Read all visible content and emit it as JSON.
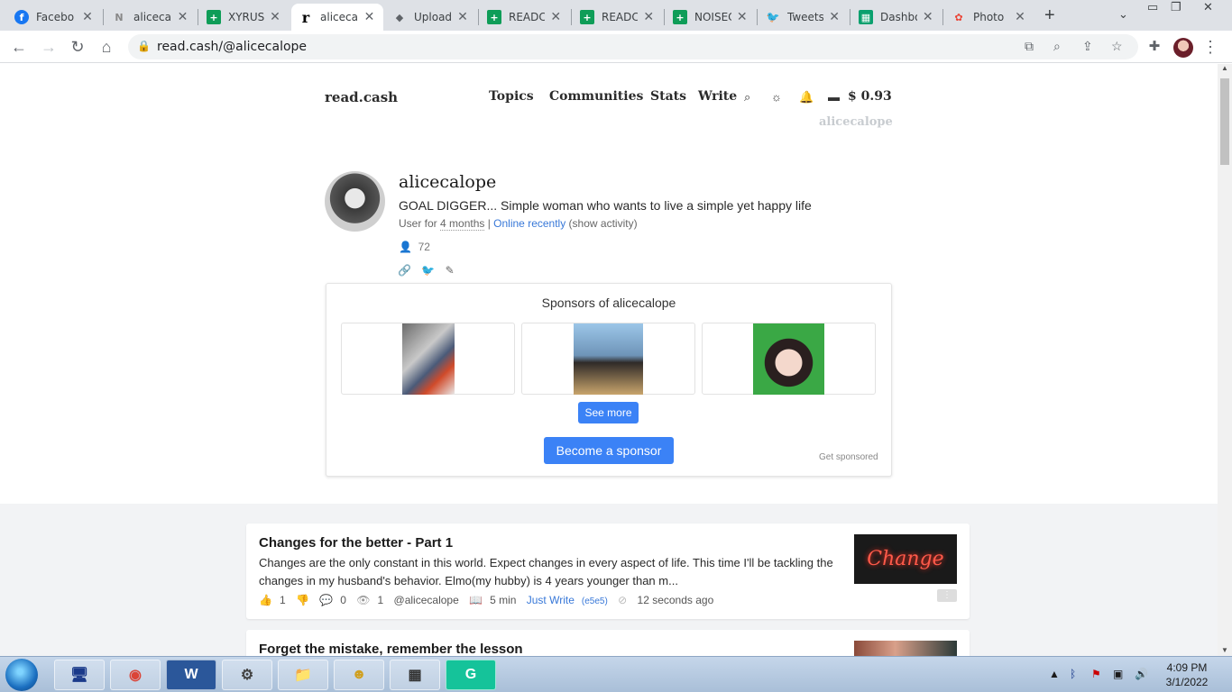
{
  "browser": {
    "tabs": [
      {
        "label": "Facebo",
        "icon": "facebook-icon",
        "color": "#1877f2",
        "glyph": "f"
      },
      {
        "label": "alicecal",
        "icon": "noise-icon",
        "color": "#888888",
        "glyph": "N"
      },
      {
        "label": "XYRUS",
        "icon": "sheets-icon",
        "color": "#0f9d58",
        "glyph": "+"
      },
      {
        "label": "alicecal",
        "icon": "readcash-icon",
        "color": "#000000",
        "glyph": "r"
      },
      {
        "label": "Upload",
        "icon": "upload-icon",
        "color": "#5f6368",
        "glyph": "◆"
      },
      {
        "label": "READC",
        "icon": "sheets-icon",
        "color": "#0f9d58",
        "glyph": "+"
      },
      {
        "label": "READC",
        "icon": "sheets-icon",
        "color": "#0f9d58",
        "glyph": "+"
      },
      {
        "label": "NOISEC",
        "icon": "sheets-icon",
        "color": "#0f9d58",
        "glyph": "+"
      },
      {
        "label": "Tweets",
        "icon": "twitter-icon",
        "color": "#1da1f2",
        "glyph": "🐦"
      },
      {
        "label": "Dashbo",
        "icon": "dashboard-icon",
        "color": "#0aa06e",
        "glyph": "▦"
      },
      {
        "label": "Photo",
        "icon": "photos-icon",
        "color": "#ea4335",
        "glyph": "✿"
      }
    ],
    "url": "read.cash/@alicecalope"
  },
  "site": {
    "logo": "read.cash",
    "nav": [
      "Topics",
      "Communities",
      "Stats",
      "Write"
    ],
    "balance": "$ 0.93",
    "username": "alicecalope"
  },
  "profile": {
    "name": "alicecalope",
    "bio": "GOAL DIGGER... Simple woman who wants to live a simple yet happy life",
    "meta_prefix": "User for ",
    "meta_duration": "4 months",
    "meta_sep": " | ",
    "meta_online": "Online recently",
    "meta_activity": " (show activity)",
    "followers": "72"
  },
  "sponsors": {
    "title": "Sponsors of alicecalope",
    "see_more": "See more",
    "become": "Become a sponsor",
    "get_sponsored": "Get sponsored"
  },
  "articles": [
    {
      "title": "Changes for the better - Part 1",
      "excerpt": "Changes are the only constant in this world. Expect changes in every aspect of life. This time I'll be tack­ling the changes in my husband's behavior. Elmo(my hubby) is 4 years younger than m...",
      "likes": "1",
      "comments": "0",
      "views": "1",
      "author": "@alicecalope",
      "read_time": "5 min",
      "community": "Just Write",
      "community_code": "(e5e5)",
      "time": "12 seconds ago",
      "thumb_text": "Change"
    },
    {
      "title": "Forget the mistake, remember the lesson"
    }
  ],
  "taskbar": {
    "apps": [
      "W",
      "G"
    ],
    "clock_time": "4:09 PM",
    "clock_date": "3/1/2022"
  }
}
